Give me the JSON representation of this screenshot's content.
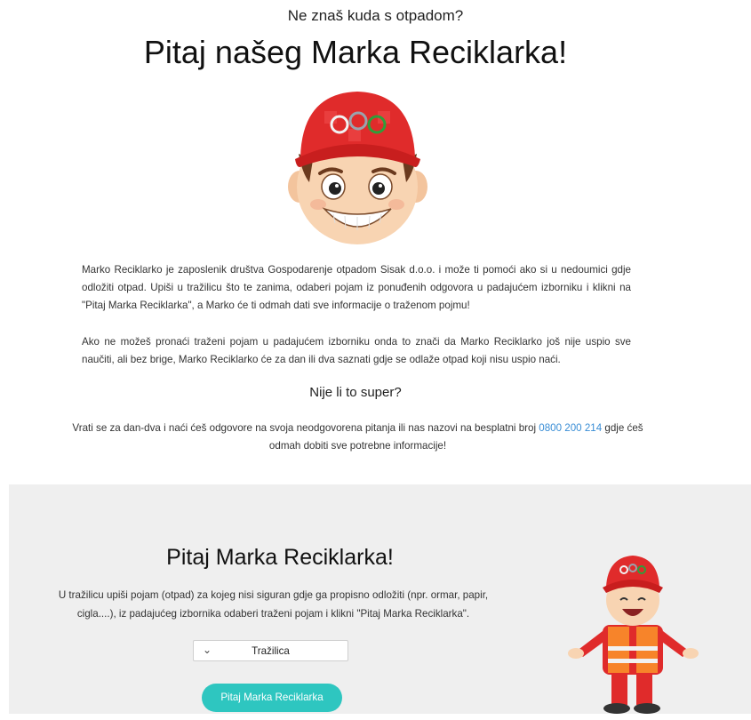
{
  "header": {
    "subtitle": "Ne znaš kuda s otpadom?",
    "title": "Pitaj našeg Marka Reciklarka!"
  },
  "intro": {
    "paragraph1": "Marko Reciklarko je zaposlenik društva Gospodarenje otpadom Sisak d.o.o. i može ti pomoći ako si u nedoumici gdje odložiti otpad. Upiši u tražilicu što te zanima, odaberi pojam iz ponuđenih odgovora u padajućem izborniku i klikni na \"Pitaj Marka Reciklarka\", a Marko će ti odmah dati sve informacije o traženom pojmu!",
    "paragraph2": "Ako ne možeš pronaći traženi pojam u padajućem izborniku onda to znači da Marko Reciklarko još nije uspio sve naučiti, ali bez brige, Marko Reciklarko će za dan ili dva saznati gdje se odlaže otpad koji nisu uspio naći.",
    "question": "Nije li to super?",
    "callback_before": "Vrati se za dan-dva i naći ćeš odgovore na svoja neodgovorena pitanja ili nas nazovi na besplatni broj ",
    "phone": "0800 200 214",
    "callback_after": " gdje ćeš odmah dobiti sve potrebne informacije!"
  },
  "ask": {
    "title": "Pitaj Marka Reciklarka!",
    "instructions": "U tražilicu upiši pojam (otpad) za kojeg nisi siguran gdje ga propisno odložiti (npr. ormar, papir, cigla....), iz padajućeg izbornika odaberi traženi pojam i klikni \"Pitaj Marka Reciklarka\".",
    "search_value": "Tražilica",
    "button_label": "Pitaj Marka Reciklarka"
  },
  "colors": {
    "accent": "#2ec6c0",
    "link": "#3a8ed6",
    "section_bg": "#efefef"
  }
}
